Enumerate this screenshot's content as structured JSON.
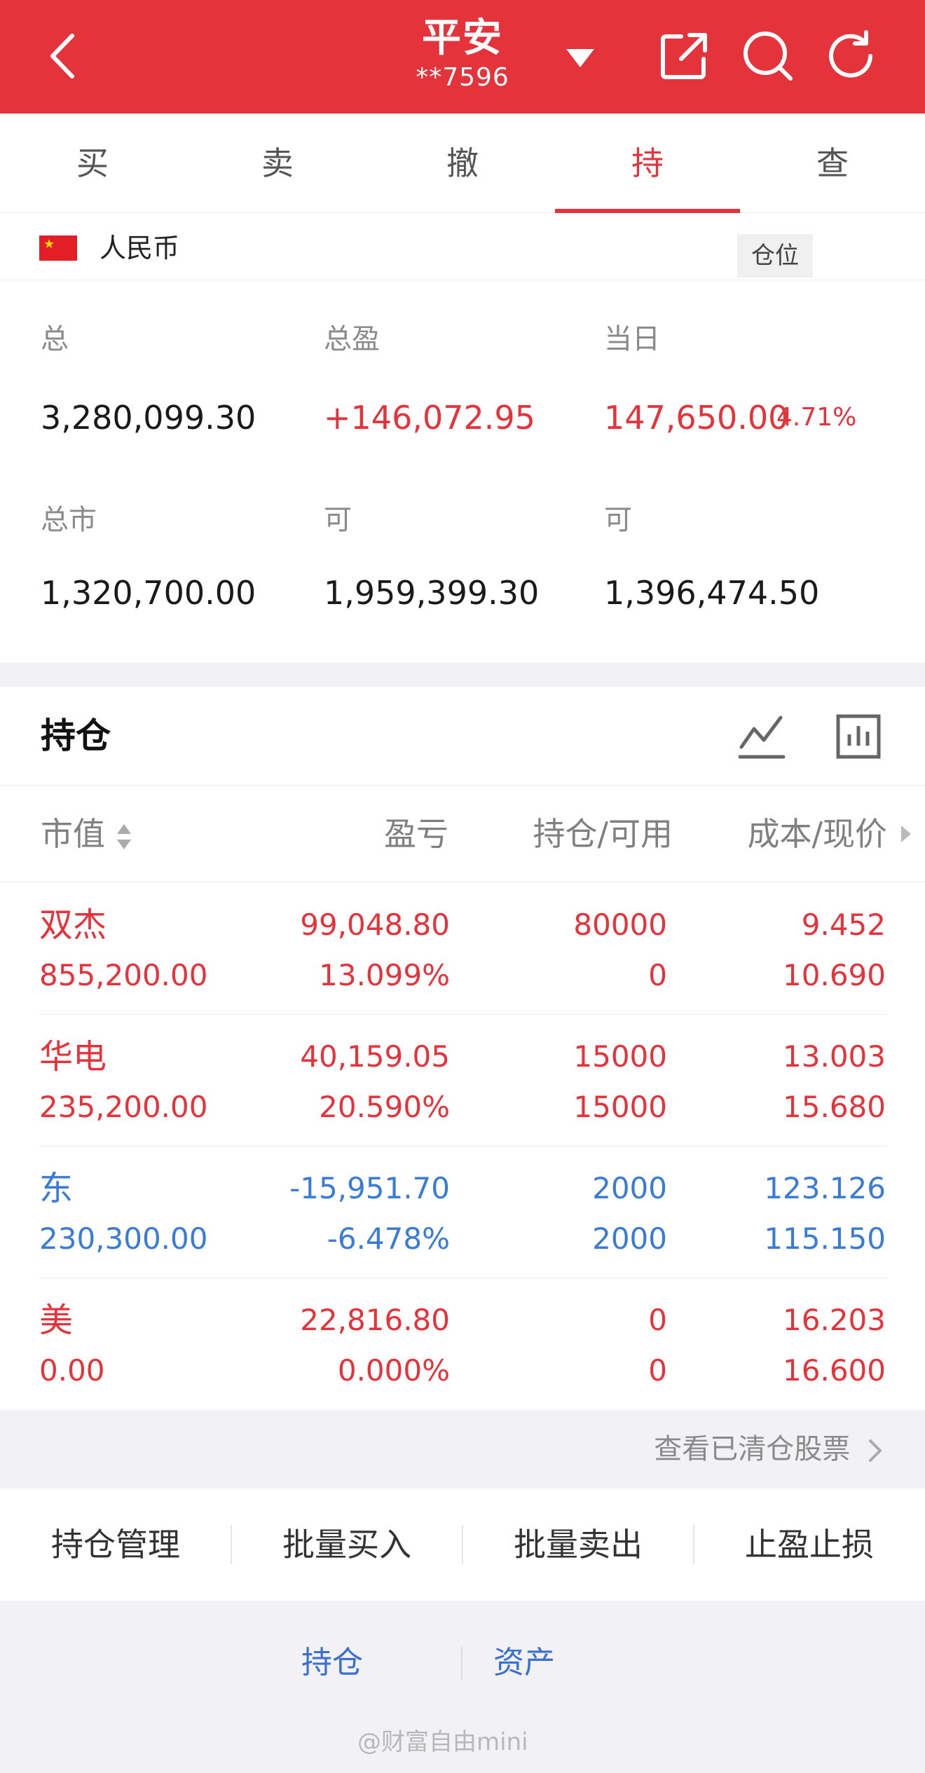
{
  "header": {
    "title": "平安",
    "account": "**7596",
    "back_icon": "chevron-left-icon",
    "share_icon": "external-link-icon",
    "search_icon": "search-icon",
    "refresh_icon": "refresh-icon"
  },
  "tabs": [
    {
      "label": "买",
      "active": false
    },
    {
      "label": "卖",
      "active": false
    },
    {
      "label": "撤",
      "active": false
    },
    {
      "label": "持",
      "active": true
    },
    {
      "label": "查",
      "active": false
    }
  ],
  "account_summary": {
    "currency": "人民币",
    "position_label": "仓位",
    "metrics": [
      {
        "label": "总",
        "value": "3,280,099.30"
      },
      {
        "label": "总盈",
        "value": "+146,072.95"
      },
      {
        "label": "当日",
        "value": "147,650.00",
        "pct": "4.71%"
      },
      {
        "label": "总市",
        "value": "1,320,700.00"
      },
      {
        "label": "可",
        "value": "1,959,399.30"
      },
      {
        "label": "可",
        "value": "1,396,474.50"
      }
    ]
  },
  "holdings": {
    "title": "持仓",
    "columns": [
      "市值",
      "盈亏",
      "持仓/可用",
      "成本/现价"
    ],
    "rows": [
      {
        "name": "双杰",
        "market_value": "855,200.00",
        "pnl": "99,048.80",
        "pnl_pct": "13.099%",
        "position": "80000",
        "available": "0",
        "cost": "9.452",
        "price": "10.690",
        "tone": "red"
      },
      {
        "name": "华电",
        "market_value": "235,200.00",
        "pnl": "40,159.05",
        "pnl_pct": "20.590%",
        "position": "15000",
        "available": "15000",
        "cost": "13.003",
        "price": "15.680",
        "tone": "red"
      },
      {
        "name": "东",
        "market_value": "230,300.00",
        "pnl": "-15,951.70",
        "pnl_pct": "-6.478%",
        "position": "2000",
        "available": "2000",
        "cost": "123.126",
        "price": "115.150",
        "tone": "blue"
      },
      {
        "name": "美",
        "market_value": "0.00",
        "pnl": "22,816.80",
        "pnl_pct": "0.000%",
        "position": "0",
        "available": "0",
        "cost": "16.203",
        "price": "16.600",
        "tone": "red"
      }
    ],
    "cleared_link": "查看已清仓股票"
  },
  "actions": [
    "持仓管理",
    "批量买入",
    "批量卖出",
    "止盈止损"
  ],
  "bottom_links": [
    "持仓",
    "资产"
  ],
  "watermark": "@财富自由mini",
  "colors": {
    "accent": "#e5333b",
    "loss": "#3a7bd5"
  }
}
